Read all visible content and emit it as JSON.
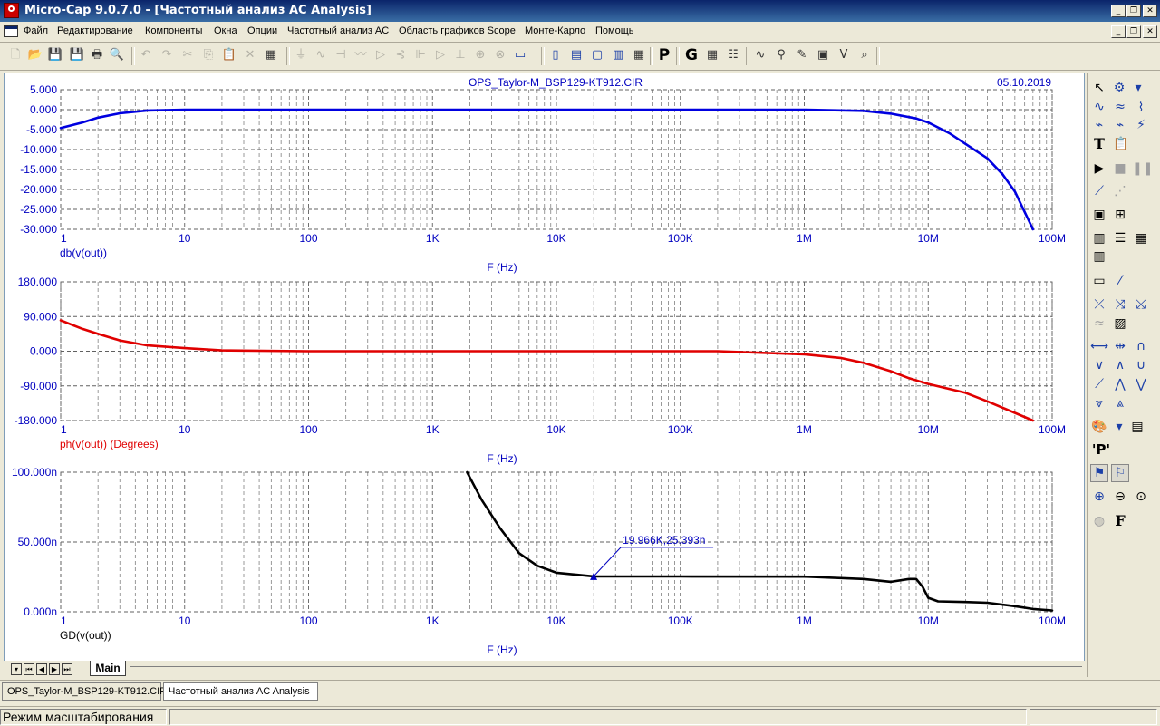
{
  "window": {
    "title": "Micro-Cap 9.0.7.0 - [Частотный анализ AC Analysis]",
    "controls": {
      "minimize": "_",
      "restore": "❐",
      "close": "✕"
    }
  },
  "menu": {
    "items": [
      "Файл",
      "Редактирование",
      "Компоненты",
      "Окна",
      "Опции",
      "Частотный анализ AC",
      "Область графиков Scope",
      "Монте-Карло",
      "Помощь"
    ]
  },
  "toolbar": {
    "buttons": [
      {
        "name": "new-icon",
        "glyph": "🗋"
      },
      {
        "name": "open-icon",
        "glyph": "📂"
      },
      {
        "name": "save-icon",
        "glyph": "💾"
      },
      {
        "name": "save-all-icon",
        "glyph": "💾"
      },
      {
        "name": "print-icon",
        "glyph": "🖶"
      },
      {
        "name": "print-preview-icon",
        "glyph": "🔍"
      },
      {
        "name": "undo-icon",
        "glyph": "↶"
      },
      {
        "name": "redo-icon",
        "glyph": "↷"
      },
      {
        "name": "cut-icon",
        "glyph": "✂"
      },
      {
        "name": "copy-icon",
        "glyph": "⎘"
      },
      {
        "name": "paste-icon",
        "glyph": "📋"
      },
      {
        "name": "delete-icon",
        "glyph": "✕"
      },
      {
        "name": "select-all-icon",
        "glyph": "▦"
      },
      {
        "name": "ground-icon",
        "glyph": "⏚"
      },
      {
        "name": "resistor-icon",
        "glyph": "∿"
      },
      {
        "name": "capacitor-icon",
        "glyph": "⊣"
      },
      {
        "name": "inductor-icon",
        "glyph": "〰"
      },
      {
        "name": "diode-icon",
        "glyph": "▷"
      },
      {
        "name": "npn-icon",
        "glyph": "⊰"
      },
      {
        "name": "nmos-icon",
        "glyph": "⊩"
      },
      {
        "name": "opamp-icon",
        "glyph": "▷"
      },
      {
        "name": "battery-icon",
        "glyph": "⊥"
      },
      {
        "name": "source-icon",
        "glyph": "⊕"
      },
      {
        "name": "jumper-icon",
        "glyph": "⊗"
      },
      {
        "name": "cascade-windows-icon",
        "glyph": "▭"
      },
      {
        "name": "tile-vertical-icon",
        "glyph": "▯"
      },
      {
        "name": "tile-horizontal-icon",
        "glyph": "▤"
      },
      {
        "name": "maximize-window-icon",
        "glyph": "▢"
      },
      {
        "name": "arrange-icon",
        "glyph": "▥"
      },
      {
        "name": "calculator-icon",
        "glyph": "▦"
      },
      {
        "name": "properties-p-icon",
        "glyph": "P"
      },
      {
        "name": "globals-g-icon",
        "glyph": "G"
      },
      {
        "name": "grid-icon",
        "glyph": "▦"
      },
      {
        "name": "table-icon",
        "glyph": "☷"
      },
      {
        "name": "analysis-wave-icon",
        "glyph": "∿"
      },
      {
        "name": "probe-icon",
        "glyph": "⚲"
      },
      {
        "name": "pencil-icon",
        "glyph": "✎"
      },
      {
        "name": "chip-icon",
        "glyph": "▣"
      },
      {
        "name": "vid-icon",
        "glyph": "V"
      },
      {
        "name": "zoom-window-icon",
        "glyph": "⌕"
      }
    ]
  },
  "plot_title": "OPS_Taylor-M_BSP129-KT912.CIR",
  "plot_date": "05.10.2019",
  "annotation": "19.966K,25.393n",
  "chart_data": [
    {
      "type": "line",
      "x_scale": "log",
      "xlim": [
        1,
        100000000
      ],
      "x_tick_labels": [
        "1",
        "10",
        "100",
        "1K",
        "10K",
        "100K",
        "1M",
        "10M",
        "100M"
      ],
      "xlabel": "F (Hz)",
      "ylabel": "db(v(out))",
      "ylim": [
        -30,
        5
      ],
      "y_tick_labels": [
        "5.000",
        "0.000",
        "-5.000",
        "-10.000",
        "-15.000",
        "-20.000",
        "-25.000",
        "-30.000"
      ],
      "grid": true,
      "color": "#0000e0",
      "x": [
        1,
        1.5,
        2,
        3,
        5,
        10,
        100,
        1000000,
        3000000,
        5000000,
        8000000,
        10000000,
        15000000,
        20000000,
        30000000,
        40000000,
        50000000,
        70000000
      ],
      "y": [
        -4.6,
        -3.2,
        -2.0,
        -0.9,
        -0.2,
        0.0,
        0.0,
        0.0,
        -0.3,
        -1.0,
        -2.2,
        -3.2,
        -6.0,
        -8.6,
        -12.2,
        -16.3,
        -20.5,
        -30.0
      ]
    },
    {
      "type": "line",
      "x_scale": "log",
      "xlim": [
        1,
        100000000
      ],
      "x_tick_labels": [
        "1",
        "10",
        "100",
        "1K",
        "10K",
        "100K",
        "1M",
        "10M",
        "100M"
      ],
      "xlabel": "F (Hz)",
      "ylabel": "ph(v(out)) (Degrees)",
      "ylim": [
        -180,
        180
      ],
      "y_tick_labels": [
        "180.000",
        "90.000",
        "0.000",
        "-90.000",
        "-180.000"
      ],
      "grid": true,
      "color": "#e00000",
      "x": [
        1,
        1.5,
        2,
        3,
        5,
        10,
        20,
        100,
        200000,
        1000000,
        2000000,
        3000000,
        5000000,
        7000000,
        10000000,
        20000000,
        30000000,
        50000000,
        70000000
      ],
      "y": [
        80,
        58,
        45,
        28,
        15,
        8,
        2,
        0,
        0,
        -8,
        -18,
        -30,
        -52,
        -70,
        -85,
        -108,
        -130,
        -160,
        -180
      ]
    },
    {
      "type": "line",
      "x_scale": "log",
      "xlim": [
        1,
        100000000
      ],
      "x_tick_labels": [
        "1",
        "10",
        "100",
        "1K",
        "10K",
        "100K",
        "1M",
        "10M",
        "100M"
      ],
      "xlabel": "F (Hz)",
      "ylabel": "GD(v(out))",
      "ylim": [
        0,
        100
      ],
      "y_tick_labels": [
        "100.000n",
        "50.000n",
        "0.000n"
      ],
      "grid": true,
      "color": "#000000",
      "x": [
        1900,
        2500,
        3500,
        5000,
        7000,
        10000,
        19966,
        100000,
        1000000,
        3000000,
        5000000,
        7000000,
        8000000,
        9000000,
        10000000,
        12000000,
        20000000,
        30000000,
        50000000,
        70000000,
        100000000
      ],
      "y": [
        100,
        80,
        60,
        42,
        33,
        28,
        25.4,
        25.3,
        25.2,
        23.5,
        21.5,
        23.5,
        23.5,
        18,
        10,
        7.5,
        7,
        6.5,
        4,
        2,
        1
      ]
    }
  ],
  "right_toolbar": {
    "buttons": [
      {
        "name": "select-arrow-icon",
        "glyph": "↖"
      },
      {
        "name": "graph-options-icon",
        "glyph": "⚙"
      },
      {
        "name": "dropdown-icon",
        "glyph": "▾"
      },
      {
        "name": "wave-a-icon",
        "glyph": "∿"
      },
      {
        "name": "wave-b-icon",
        "glyph": "≈"
      },
      {
        "name": "wave-c-icon",
        "glyph": "⌇"
      },
      {
        "name": "wave-d-icon",
        "glyph": "⌁"
      },
      {
        "name": "wave-e-icon",
        "glyph": "⌁"
      },
      {
        "name": "wave-f-icon",
        "glyph": "⚡"
      },
      {
        "name": "text-icon",
        "glyph": "T"
      },
      {
        "name": "clipboard-icon",
        "glyph": "📋"
      },
      {
        "name": "run-icon",
        "glyph": "▶"
      },
      {
        "name": "stop-icon",
        "glyph": "■"
      },
      {
        "name": "pause-icon",
        "glyph": "❚❚"
      },
      {
        "name": "line-icon",
        "glyph": "⟋"
      },
      {
        "name": "dotted-line-icon",
        "glyph": "⋰"
      },
      {
        "name": "frame-icon",
        "glyph": "▣"
      },
      {
        "name": "grid-toggle-icon",
        "glyph": "⊞"
      },
      {
        "name": "minor-grid-icon",
        "glyph": "▥"
      },
      {
        "name": "major-grid-icon",
        "glyph": "☰"
      },
      {
        "name": "fine-grid-icon",
        "glyph": "▦"
      },
      {
        "name": "axis-grid-icon",
        "glyph": "▥"
      },
      {
        "name": "scale-icon",
        "glyph": "▭"
      },
      {
        "name": "scatter-icon",
        "glyph": "⁄"
      },
      {
        "name": "cursor-a-icon",
        "glyph": "⤫"
      },
      {
        "name": "cursor-b-icon",
        "glyph": "⤨"
      },
      {
        "name": "cursor-c-icon",
        "glyph": "⤩"
      },
      {
        "name": "curve-icon",
        "glyph": "≈"
      },
      {
        "name": "chart-icon",
        "glyph": "▨"
      },
      {
        "name": "peak-a-icon",
        "glyph": "⟷"
      },
      {
        "name": "peak-b-icon",
        "glyph": "⇹"
      },
      {
        "name": "peak-c-icon",
        "glyph": "∩"
      },
      {
        "name": "valley-a-icon",
        "glyph": "∨"
      },
      {
        "name": "valley-b-icon",
        "glyph": "∧"
      },
      {
        "name": "valley-c-icon",
        "glyph": "∪"
      },
      {
        "name": "slope-a-icon",
        "glyph": "⟋"
      },
      {
        "name": "slope-b-icon",
        "glyph": "⋀"
      },
      {
        "name": "slope-c-icon",
        "glyph": "⋁"
      },
      {
        "name": "mark-a-icon",
        "glyph": "⩔"
      },
      {
        "name": "mark-b-icon",
        "glyph": "⩓"
      },
      {
        "name": "palette-icon",
        "glyph": "🎨"
      },
      {
        "name": "palette-dropdown-icon",
        "glyph": "▾"
      },
      {
        "name": "table-view-icon",
        "glyph": "▤"
      },
      {
        "name": "p-label-icon",
        "glyph": "'P'"
      },
      {
        "name": "tag-a-icon",
        "glyph": "⚑"
      },
      {
        "name": "tag-b-icon",
        "glyph": "⚐"
      },
      {
        "name": "zoom-in-icon",
        "glyph": "⊕"
      },
      {
        "name": "zoom-out-icon",
        "glyph": "⊖"
      },
      {
        "name": "zoom-fit-icon",
        "glyph": "⊙"
      },
      {
        "name": "globe-icon",
        "glyph": "◍"
      },
      {
        "name": "function-icon",
        "glyph": "F"
      }
    ]
  },
  "sheet_tab": "Main",
  "doc_tabs": [
    "OPS_Taylor-M_BSP129-KT912.CIR",
    "Частотный анализ AC Analysis"
  ],
  "status": "Режим масштабирования"
}
